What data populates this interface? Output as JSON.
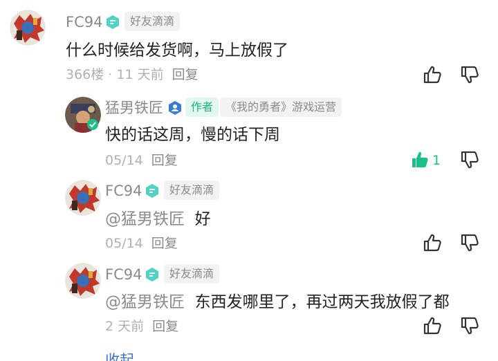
{
  "colors": {
    "accent": "#18c08a",
    "tag_bg": "#f2f2f2",
    "author_tag_bg": "#e3f7ef",
    "link": "#3c6fd0"
  },
  "comments": [
    {
      "username": "FC94",
      "badge_icon": "friend-badge-icon",
      "tag": "好友滴滴",
      "text": "什么时候给发货啊，马上放假了",
      "meta": "366楼 · 11 天前",
      "reply_label": "回复"
    },
    {
      "username": "猛男铁匠",
      "badge_icon": "verified-person-icon",
      "author_tag": "作者",
      "tag": "《我的勇者》游戏运营",
      "text": "快的话这周，慢的话下周",
      "meta": "05/14",
      "reply_label": "回复",
      "like_count": "1"
    },
    {
      "username": "FC94",
      "badge_icon": "friend-badge-icon",
      "tag": "好友滴滴",
      "mention": "@猛男铁匠",
      "text": "好",
      "meta": "05/14",
      "reply_label": "回复"
    },
    {
      "username": "FC94",
      "badge_icon": "friend-badge-icon",
      "tag": "好友滴滴",
      "mention": "@猛男铁匠",
      "text": "东西发哪里了，再过两天我放假了都",
      "meta": "2 天前",
      "reply_label": "回复"
    }
  ],
  "collapse_label": "收起"
}
